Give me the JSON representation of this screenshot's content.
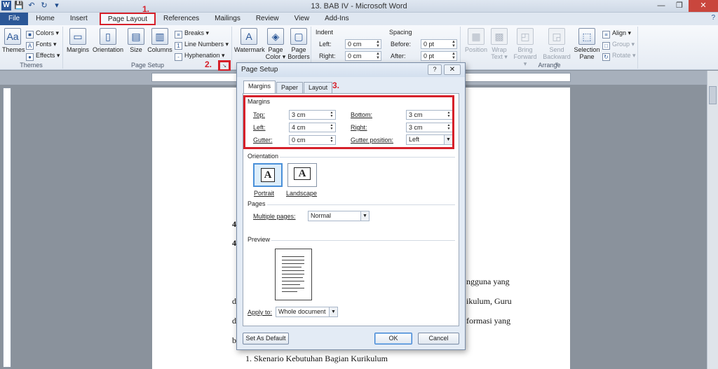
{
  "window": {
    "title": "13. BAB IV  -  Microsoft Word",
    "minimize": "—",
    "restore": "❐",
    "close": "✕"
  },
  "qat": {
    "logo": "W",
    "save": "💾",
    "undo": "↶",
    "redo": "↻",
    "more": "▾"
  },
  "tabs": [
    {
      "label": "File"
    },
    {
      "label": "Home"
    },
    {
      "label": "Insert"
    },
    {
      "label": "Page Layout"
    },
    {
      "label": "References"
    },
    {
      "label": "Mailings"
    },
    {
      "label": "Review"
    },
    {
      "label": "View"
    },
    {
      "label": "Add-Ins"
    }
  ],
  "help_icon": "?",
  "steps": [
    "1.",
    "2.",
    "3."
  ],
  "ribbon": {
    "themes": {
      "big": "Themes",
      "colors": "Colors ▾",
      "fonts": "Fonts ▾",
      "effects": "Effects ▾",
      "group": "Themes"
    },
    "page_setup": {
      "margins": "Margins",
      "orientation": "Orientation",
      "size": "Size",
      "columns": "Columns",
      "breaks": "Breaks ▾",
      "line_numbers": "Line Numbers ▾",
      "hyphenation": "Hyphenation ▾",
      "group": "Page Setup"
    },
    "page_background": {
      "watermark": "Watermark",
      "page_color": "Page\nColor ▾",
      "page_borders": "Page\nBorders"
    },
    "paragraph": {
      "indent": "Indent",
      "left": "Left:",
      "left_val": "0 cm",
      "right": "Right:",
      "right_val": "0 cm",
      "spacing": "Spacing",
      "before": "Before:",
      "before_val": "0 pt",
      "after": "After:",
      "after_val": "0 pt"
    },
    "arrange": {
      "position": "Position",
      "wrap_text": "Wrap\nText ▾",
      "bring_forward": "Bring\nForward ▾",
      "send_backward": "Send\nBackward ▾",
      "selection_pane": "Selection\nPane",
      "align": "Align ▾",
      "group_btn": "Group ▾",
      "rotate": "Rotate ▾",
      "group": "Arrange"
    }
  },
  "document": {
    "line1_prefix": "4",
    "line2_prefix": "4",
    "line3_suffix": "ngguna  yang",
    "line4_prefix": "d",
    "line4_suffix": "ikulum, Guru",
    "line5_prefix": "d",
    "line5_suffix": "formasi  yang",
    "line6_prefix": "b",
    "line7": "1.  Skenario Kebutuhan Bagian Kurikulum"
  },
  "dialog": {
    "title": "Page Setup",
    "help": "?",
    "close": "✕",
    "tabs": [
      {
        "label": "Margins"
      },
      {
        "label": "Paper"
      },
      {
        "label": "Layout"
      }
    ],
    "margins": {
      "section": "Margins",
      "top_label": "Top:",
      "top_value": "3 cm",
      "bottom_label": "Bottom:",
      "bottom_value": "3 cm",
      "left_label": "Left:",
      "left_value": "4 cm",
      "right_label": "Right:",
      "right_value": "3 cm",
      "gutter_label": "Gutter:",
      "gutter_value": "0 cm",
      "gutter_pos_label": "Gutter position:",
      "gutter_pos_value": "Left"
    },
    "orientation": {
      "section": "Orientation",
      "portrait": "Portrait",
      "landscape": "Landscape",
      "glyph": "A"
    },
    "pages": {
      "section": "Pages",
      "multiple_label": "Multiple pages:",
      "multiple_value": "Normal"
    },
    "preview": {
      "section": "Preview"
    },
    "apply": {
      "label": "Apply to:",
      "value": "Whole document"
    },
    "buttons": {
      "default": "Set As Default",
      "ok": "OK",
      "cancel": "Cancel"
    }
  },
  "accent": {
    "file_tab": "#2b5797",
    "highlight": "#d6202a"
  }
}
